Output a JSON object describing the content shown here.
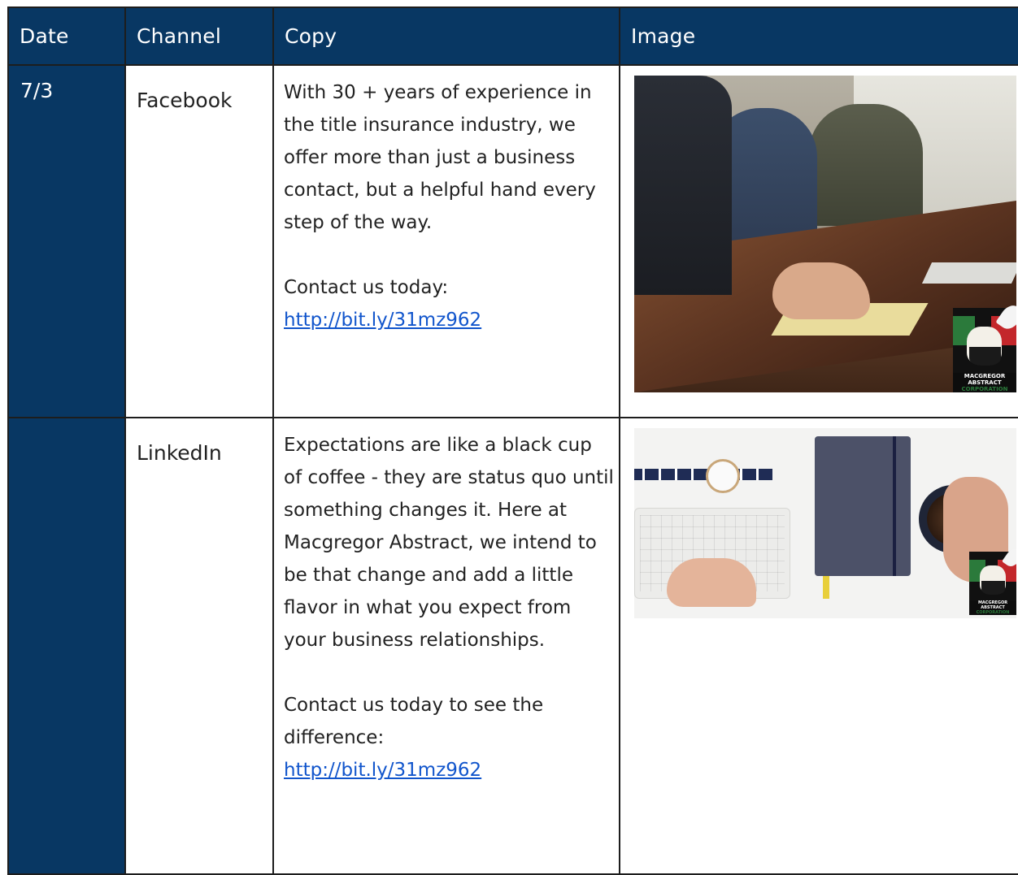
{
  "headers": {
    "date": "Date",
    "channel": "Channel",
    "copy": "Copy",
    "image": "Image"
  },
  "rows": [
    {
      "date": "7/3",
      "channel": "Facebook",
      "copy_paragraph": "With 30 + years of experience in the title insurance industry, we offer more than just a business contact, but a helpful hand every step of the way.",
      "copy_cta": "Contact us today:",
      "copy_link": "http://bit.ly/31mz962",
      "image_logo": {
        "line1": "MACGREGOR",
        "line2": "ABSTRACT",
        "line3": "CORPORATION"
      }
    },
    {
      "date": "",
      "channel": "LinkedIn",
      "copy_paragraph": "Expectations are like a black cup of coffee - they are status quo until something changes it. Here at Macgregor Abstract, we intend to be that change and add a little flavor in what you expect from your business relationships.",
      "copy_cta": "Contact us today to see the difference:",
      "copy_link": "http://bit.ly/31mz962",
      "image_logo": {
        "line1": "MACGREGOR",
        "line2": "ABSTRACT",
        "line3": "CORPORATION"
      }
    }
  ],
  "colors": {
    "header_bg": "#083763",
    "date_col_bg": "#083763",
    "link": "#1155cc",
    "border": "#1d1d1d"
  }
}
